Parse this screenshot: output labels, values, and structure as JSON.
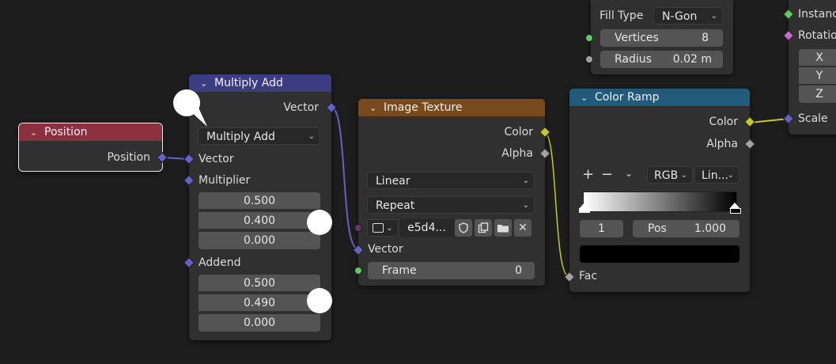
{
  "nodes": {
    "position": {
      "title": "Position",
      "output": "Position",
      "header_color": "#8c3040"
    },
    "multiply_add": {
      "title": "Multiply Add",
      "header_color": "#3c3c83",
      "output": "Vector",
      "operation": "Multiply Add",
      "input_vector": "Vector",
      "multiplier_label": "Multiplier",
      "multiplier": [
        "0.500",
        "0.400",
        "0.000"
      ],
      "addend_label": "Addend",
      "addend": [
        "0.500",
        "0.490",
        "0.000"
      ]
    },
    "image_texture": {
      "title": "Image Texture",
      "header_color": "#7a4a1f",
      "out_color": "Color",
      "out_alpha": "Alpha",
      "interpolation": "Linear",
      "extension": "Repeat",
      "image_name": "e5d4...",
      "in_vector": "Vector",
      "frame_label": "Frame",
      "frame_value": "0"
    },
    "color_ramp": {
      "title": "Color Ramp",
      "header_color": "#235a7a",
      "out_color": "Color",
      "out_alpha": "Alpha",
      "add": "+",
      "remove": "−",
      "color_mode": "RGB",
      "interp": "Lin...",
      "stop_index": "1",
      "pos_label": "Pos",
      "pos_value": "1.000",
      "in_fac": "Fac"
    },
    "mesh_circle": {
      "fill_type_label": "Fill Type",
      "fill_type_value": "N-Gon",
      "vertices_label": "Vertices",
      "vertices_value": "8",
      "radius_label": "Radius",
      "radius_value": "0.02 m"
    },
    "instance": {
      "instance_label": "Instanc",
      "rotation_label": "Rotatio",
      "x": "X",
      "y": "Y",
      "z": "Z",
      "scale_label": "Scale"
    }
  },
  "icons": {
    "chevron": "chevron-down-icon",
    "image": "image-icon",
    "shield": "fake-user-shield-icon",
    "duplicate": "duplicate-icon",
    "folder": "folder-icon",
    "close": "close-icon"
  }
}
